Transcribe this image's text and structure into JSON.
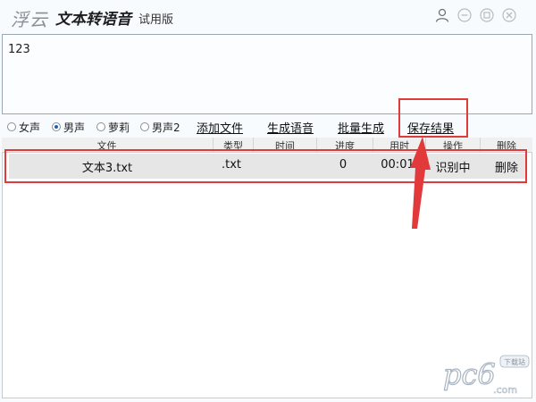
{
  "titlebar": {
    "logo_text": "浮云",
    "app_name": "文本转语音",
    "edition": "试用版"
  },
  "editor": {
    "value": "123"
  },
  "voices": [
    {
      "label": "女声",
      "checked": false
    },
    {
      "label": "男声",
      "checked": true
    },
    {
      "label": "萝莉",
      "checked": false
    },
    {
      "label": "男声2",
      "checked": false
    }
  ],
  "actions": {
    "add_file": "添加文件",
    "generate": "生成语音",
    "batch": "批量生成",
    "save": "保存结果"
  },
  "table": {
    "columns": [
      "文件",
      "类型",
      "时间",
      "进度",
      "用时",
      "操作",
      "删除"
    ],
    "rows": [
      [
        "文本3.txt",
        ".txt",
        "",
        "0",
        "00:01",
        "识别中",
        "删除"
      ]
    ]
  },
  "watermark": {
    "brand": "pc6",
    "suffix": ".com",
    "badge": "下载站"
  },
  "colors": {
    "highlight": "#e23a3a",
    "accent": "#1f5fb3"
  },
  "icons": [
    "user-icon",
    "minimize-icon",
    "maximize-icon",
    "close-icon"
  ]
}
